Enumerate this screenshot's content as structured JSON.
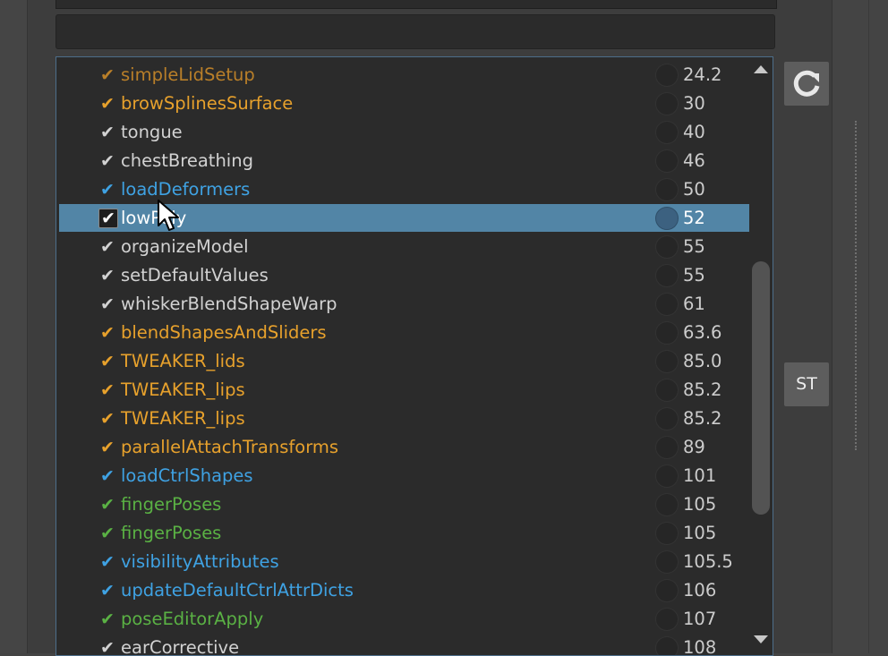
{
  "colors": {
    "orange": "#e7a12c",
    "orange_dim": "#b97f29",
    "white": "#d2d2d2",
    "blue": "#3fa2e3",
    "green": "#5ab144",
    "selected_bg": "#5285a6"
  },
  "list": {
    "rows": [
      {
        "name": "simpleLidSetup",
        "value": "24.2",
        "color": "#b97f29",
        "selected": false
      },
      {
        "name": "browSplinesSurface",
        "value": "30",
        "color": "#e7a12c",
        "selected": false
      },
      {
        "name": "tongue",
        "value": "40",
        "color": "#d2d2d2",
        "selected": false
      },
      {
        "name": "chestBreathing",
        "value": "46",
        "color": "#d2d2d2",
        "selected": false
      },
      {
        "name": "loadDeformers",
        "value": "50",
        "color": "#3fa2e3",
        "selected": false
      },
      {
        "name": "lowPoly",
        "value": "52",
        "color": "#ffffff",
        "selected": true
      },
      {
        "name": "organizeModel",
        "value": "55",
        "color": "#d2d2d2",
        "selected": false
      },
      {
        "name": "setDefaultValues",
        "value": "55",
        "color": "#d2d2d2",
        "selected": false
      },
      {
        "name": "whiskerBlendShapeWarp",
        "value": "61",
        "color": "#d2d2d2",
        "selected": false
      },
      {
        "name": "blendShapesAndSliders",
        "value": "63.6",
        "color": "#e7a12c",
        "selected": false
      },
      {
        "name": "TWEAKER_lids",
        "value": "85.0",
        "color": "#e7a12c",
        "selected": false
      },
      {
        "name": "TWEAKER_lips",
        "value": "85.2",
        "color": "#e7a12c",
        "selected": false
      },
      {
        "name": "TWEAKER_lips",
        "value": "85.2",
        "color": "#e7a12c",
        "selected": false
      },
      {
        "name": "parallelAttachTransforms",
        "value": "89",
        "color": "#e7a12c",
        "selected": false
      },
      {
        "name": "loadCtrlShapes",
        "value": "101",
        "color": "#3fa2e3",
        "selected": false
      },
      {
        "name": "fingerPoses",
        "value": "105",
        "color": "#5ab144",
        "selected": false
      },
      {
        "name": "fingerPoses",
        "value": "105",
        "color": "#5ab144",
        "selected": false
      },
      {
        "name": "visibilityAttributes",
        "value": "105.5",
        "color": "#3fa2e3",
        "selected": false
      },
      {
        "name": "updateDefaultCtrlAttrDicts",
        "value": "106",
        "color": "#3fa2e3",
        "selected": false
      },
      {
        "name": "poseEditorApply",
        "value": "107",
        "color": "#5ab144",
        "selected": false
      },
      {
        "name": "earCorrective",
        "value": "108",
        "color": "#d2d2d2",
        "selected": false
      }
    ],
    "check_glyph": "✔",
    "scroll_up_icon": "triangle-up-icon",
    "scroll_down_icon": "triangle-down-icon"
  },
  "side": {
    "refresh_icon": "refresh-icon",
    "st_label": "ST"
  }
}
